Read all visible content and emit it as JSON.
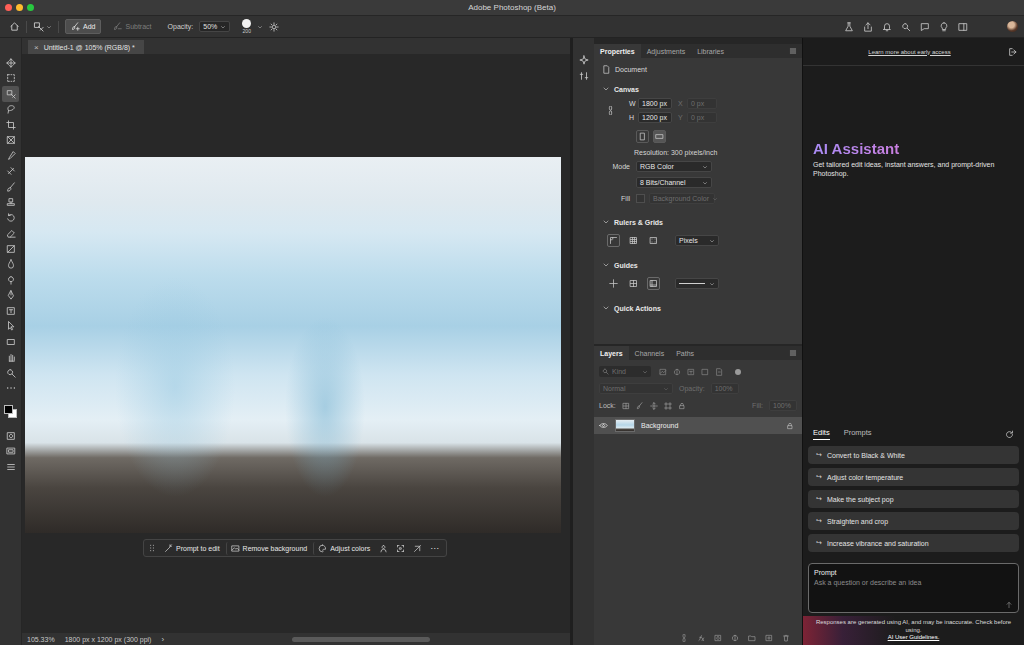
{
  "window": {
    "title": "Adobe Photoshop (Beta)"
  },
  "options_bar": {
    "modes": [
      {
        "label": "Add",
        "selected": true
      },
      {
        "label": "Subtract",
        "selected": false
      }
    ],
    "opacity": {
      "label": "Opacity:",
      "value": "50%"
    },
    "brush_size": "200"
  },
  "toolbar": {
    "tools": [
      {
        "selected": false
      },
      {
        "selected": false
      },
      {
        "selected": true
      },
      {
        "selected": false
      },
      {
        "selected": false
      },
      {
        "selected": false
      },
      {
        "selected": false
      },
      {
        "selected": false
      },
      {
        "selected": false
      },
      {
        "selected": false
      },
      {
        "selected": false
      },
      {
        "selected": false
      },
      {
        "selected": false
      },
      {
        "selected": false
      },
      {
        "selected": false
      },
      {
        "selected": false
      },
      {
        "selected": false
      },
      {
        "selected": false
      },
      {
        "selected": false
      },
      {
        "selected": false
      },
      {
        "selected": false
      },
      {
        "selected": false
      }
    ]
  },
  "document": {
    "tab": "Untitled-1 @ 105% (RGB/8) *",
    "close": "×",
    "taskbar": {
      "buttons": [
        "Prompt to edit",
        "Remove background",
        "Adjust colors"
      ],
      "more": "···"
    }
  },
  "status_bar": {
    "zoom": "105.33%",
    "info": "1800 px x 1200 px (300 ppi)",
    "arrow": "›"
  },
  "properties": {
    "tabs": [
      {
        "label": "Properties",
        "selected": true
      },
      {
        "label": "Adjustments",
        "selected": false
      },
      {
        "label": "Libraries",
        "selected": false
      }
    ],
    "kind": "Document",
    "canvas": {
      "title": "Canvas",
      "fields": [
        {
          "label": "W",
          "value": "1800 px",
          "disabled": false
        },
        {
          "label": "X",
          "value": "0 px",
          "disabled": true
        },
        {
          "label": "H",
          "value": "1200 px",
          "disabled": false
        },
        {
          "label": "Y",
          "value": "0 px",
          "disabled": true
        }
      ],
      "resolution": "Resolution: 300 pixels/inch",
      "mode_label": "Mode",
      "mode": "RGB Color",
      "depth": "8 Bits/Channel",
      "fill_label": "Fill",
      "fill": "Background Color",
      "fill_disabled": true
    },
    "rulers": {
      "title": "Rulers & Grids",
      "units": "Pixels"
    },
    "guides": {
      "title": "Guides"
    },
    "quick_actions": {
      "title": "Quick Actions"
    }
  },
  "layers": {
    "tabs": [
      {
        "label": "Layers",
        "selected": true
      },
      {
        "label": "Channels",
        "selected": false
      },
      {
        "label": "Paths",
        "selected": false
      }
    ],
    "filter": "Kind",
    "blend_mode": "Normal",
    "opacity": {
      "label": "Opacity:",
      "value": "100%"
    },
    "lock_label": "Lock:",
    "fill": {
      "label": "Fill:",
      "value": "100%"
    },
    "controls_disabled": true,
    "items": [
      {
        "name": "Background",
        "visible": true,
        "locked": true,
        "selected": true
      }
    ]
  },
  "ai_assistant": {
    "link": "Learn more about early access",
    "title": "AI Assistant",
    "description": "Get tailored edit ideas, instant answers, and prompt-driven Photoshop.",
    "tabs": [
      {
        "label": "Edits",
        "selected": true
      },
      {
        "label": "Prompts",
        "selected": false
      }
    ],
    "suggestion_icon": "↪",
    "suggestions": [
      "Convert to Black & White",
      "Adjust color temperature",
      "Make the subject pop",
      "Straighten and crop",
      "Increase vibrance and saturation"
    ],
    "prompt": {
      "label": "Prompt",
      "placeholder": "Ask a question or describe an idea"
    },
    "disclaimer": "Responses are generated using AI, and may be inaccurate. Check before using.",
    "guidelines": "AI User Guidelines."
  }
}
